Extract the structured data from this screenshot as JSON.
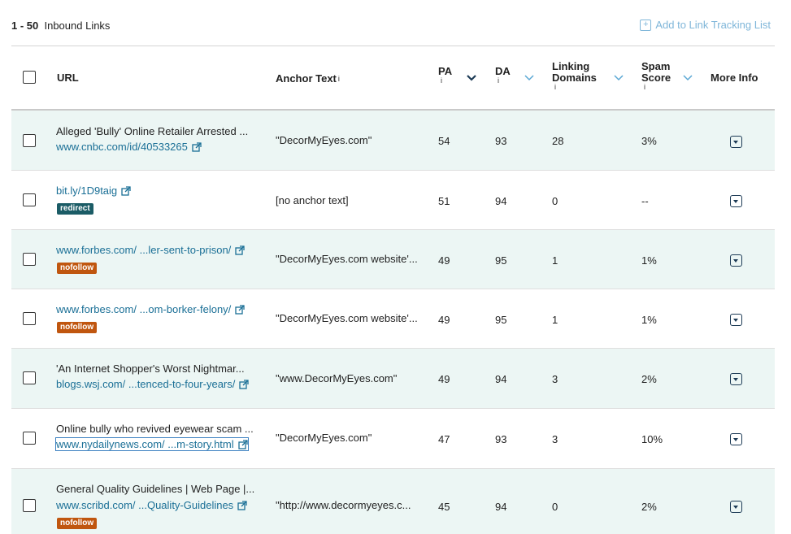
{
  "header": {
    "range": "1 - 50",
    "range_label": "Inbound Links",
    "add_button": "Add to Link Tracking List"
  },
  "columns": {
    "url": "URL",
    "anchor": "Anchor Text",
    "pa": "PA",
    "da": "DA",
    "linking_1": "Linking",
    "linking_2": "Domains",
    "spam_1": "Spam",
    "spam_2": "Score",
    "more": "More Info",
    "info_glyph": "i"
  },
  "rows": [
    {
      "title": "Alleged 'Bully' Online Retailer Arrested ...",
      "url": "www.cnbc.com/id/40533265",
      "badge": "",
      "anchor": "\"DecorMyEyes.com\"",
      "pa": "54",
      "da": "93",
      "ld": "28",
      "spam": "3%"
    },
    {
      "title": "",
      "url": "bit.ly/1D9taig",
      "badge": "redirect",
      "anchor": "[no anchor text]",
      "pa": "51",
      "da": "94",
      "ld": "0",
      "spam": "--"
    },
    {
      "title": "",
      "url": "www.forbes.com/ ...ler-sent-to-prison/",
      "badge": "nofollow",
      "anchor": "\"DecorMyEyes.com website'...",
      "pa": "49",
      "da": "95",
      "ld": "1",
      "spam": "1%"
    },
    {
      "title": "",
      "url": "www.forbes.com/ ...om-borker-felony/",
      "badge": "nofollow",
      "anchor": "\"DecorMyEyes.com website'...",
      "pa": "49",
      "da": "95",
      "ld": "1",
      "spam": "1%"
    },
    {
      "title": "'An Internet Shopper's Worst Nightmar...",
      "url": "blogs.wsj.com/ ...tenced-to-four-years/",
      "badge": "",
      "anchor": "\"www.DecorMyEyes.com\"",
      "pa": "49",
      "da": "94",
      "ld": "3",
      "spam": "2%"
    },
    {
      "title": "Online bully who revived eyewear scam ...",
      "url": "www.nydailynews.com/ ...m-story.html",
      "badge": "",
      "anchor": "\"DecorMyEyes.com\"",
      "pa": "47",
      "da": "93",
      "ld": "3",
      "spam": "10%"
    },
    {
      "title": "General Quality Guidelines | Web Page |...",
      "url": "www.scribd.com/ ...Quality-Guidelines",
      "badge": "nofollow",
      "anchor": "\"http://www.decormyeyes.c...",
      "pa": "45",
      "da": "94",
      "ld": "0",
      "spam": "2%"
    }
  ]
}
